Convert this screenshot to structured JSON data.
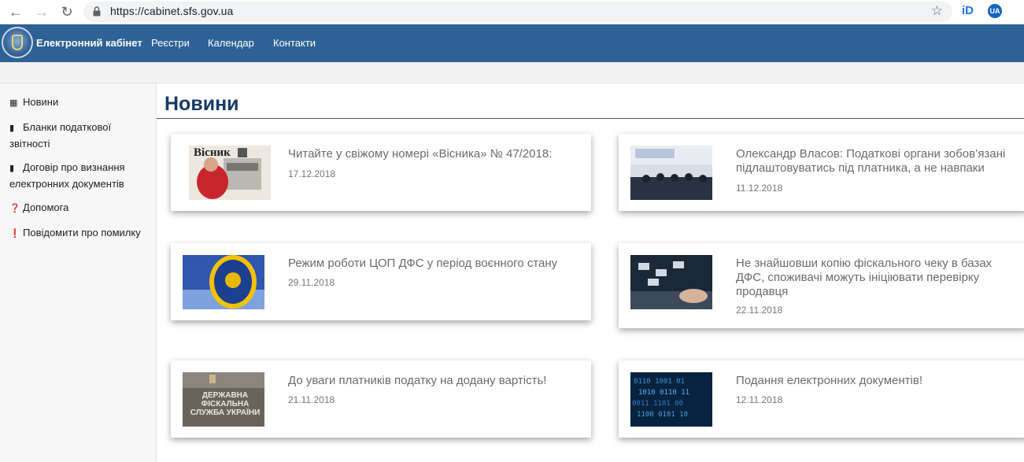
{
  "browser": {
    "url": "https://cabinet.sfs.gov.ua",
    "ext1_label": "iD",
    "ext2_label": "UA"
  },
  "header": {
    "brand": "Електронний кабінет",
    "menu": [
      "Реєстри",
      "Календар",
      "Контакти"
    ]
  },
  "sidebar": {
    "items": [
      {
        "icon": "newspaper-icon",
        "label": "Новини"
      },
      {
        "icon": "book-icon",
        "label": "Бланки податкової звітності"
      },
      {
        "icon": "book-icon",
        "label": "Договір про визнання електронних документів"
      },
      {
        "icon": "question-circle-icon",
        "label": "Допомога"
      },
      {
        "icon": "exclamation-circle-icon",
        "label": "Повідомити про помилку"
      }
    ]
  },
  "main": {
    "title": "Новини",
    "news": [
      {
        "title": "Читайте у свіжому номері «Вісника» № 47/2018:",
        "date": "17.12.2018",
        "thumb_text": "Вісник"
      },
      {
        "title": "Олександр Власов: Податкові органи зобов’язані підлаштовуватись під платника, а не навпаки",
        "date": "11.12.2018",
        "thumb_text": ""
      },
      {
        "title": "Режим роботи ЦОП ДФС у період воєнного стану",
        "date": "29.11.2018",
        "thumb_text": ""
      },
      {
        "title": "Не знайшовши копію фіскального чеку в базах ДФС, споживачі можуть ініціювати перевірку продавця",
        "date": "22.11.2018",
        "thumb_text": ""
      },
      {
        "title": "До уваги платників податку на додану вартість!",
        "date": "21.11.2018",
        "thumb_text": "ДЕРЖАВНА ФІСКАЛЬНА СЛУЖБА УКРАЇНИ"
      },
      {
        "title": "Подання електронних документів!",
        "date": "12.11.2018",
        "thumb_text": ""
      }
    ]
  }
}
